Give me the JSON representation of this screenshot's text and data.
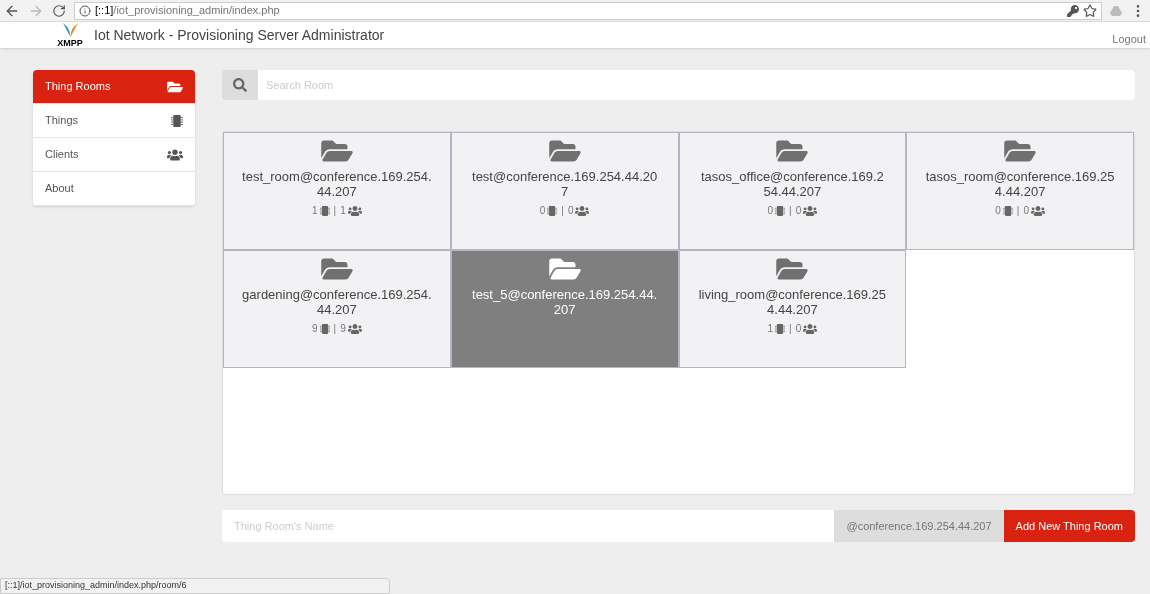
{
  "browser": {
    "url_host": "[::1]",
    "url_path": "/iot_provisioning_admin/index.php"
  },
  "header": {
    "title": "Iot Network - Provisioning Server Administrator",
    "logo_text": "XMPP",
    "logout": "Logout"
  },
  "sidebar": {
    "items": [
      {
        "label": "Thing Rooms",
        "selected": true
      },
      {
        "label": "Things",
        "selected": false
      },
      {
        "label": "Clients",
        "selected": false
      },
      {
        "label": "About",
        "selected": false
      }
    ]
  },
  "search": {
    "placeholder": "Search Room"
  },
  "rooms": [
    {
      "name": "test_room@conference.169.254.44.207",
      "things": "1",
      "separator": "|",
      "clients": "1",
      "selected": false
    },
    {
      "name": "test@conference.169.254.44.207",
      "things": "0",
      "separator": "|",
      "clients": "0",
      "selected": false
    },
    {
      "name": "tasos_office@conference.169.254.44.207",
      "things": "0",
      "separator": "|",
      "clients": "0",
      "selected": false
    },
    {
      "name": "tasos_room@conference.169.254.44.207",
      "things": "0",
      "separator": "|",
      "clients": "0",
      "selected": false
    },
    {
      "name": "gardening@conference.169.254.44.207",
      "things": "9",
      "separator": "|",
      "clients": "9",
      "selected": false
    },
    {
      "name": "test_5@conference.169.254.44.207",
      "selected": true
    },
    {
      "name": "living_room@conference.169.254.44.207",
      "things": "1",
      "separator": "|",
      "clients": "0",
      "selected": false
    }
  ],
  "new_room": {
    "placeholder": "Thing Room's Name",
    "suffix": "@conference.169.254.44.207",
    "button": "Add New Thing Room"
  },
  "status_bar": "[::1]/iot_provisioning_admin/index.php/room/6"
}
